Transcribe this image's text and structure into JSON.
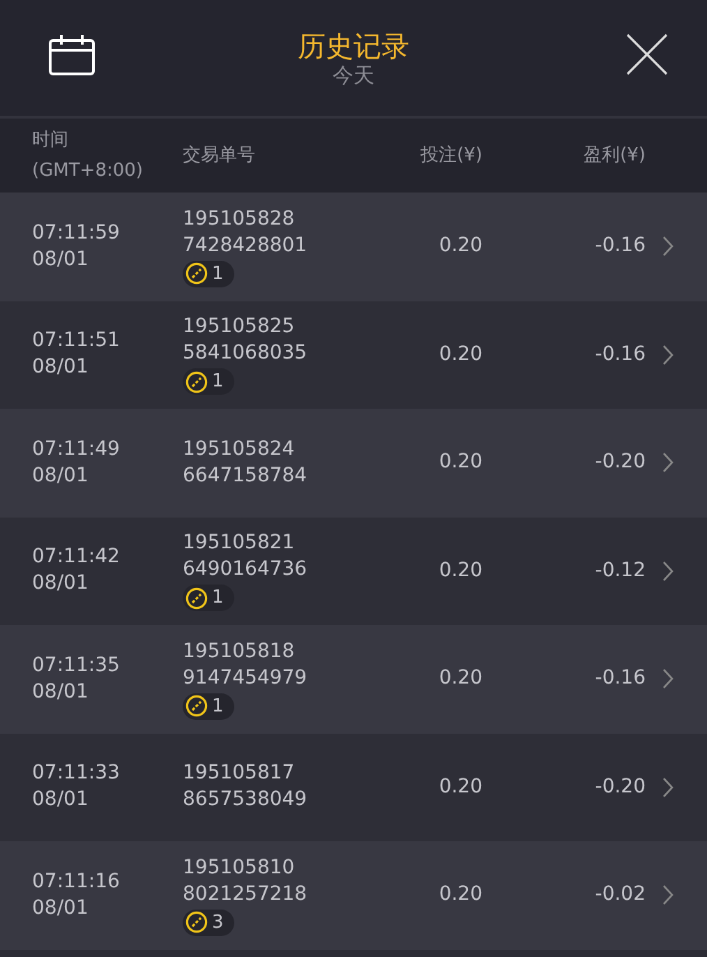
{
  "header": {
    "title": "历史记录",
    "subtitle": "今天"
  },
  "columns": [
    {
      "lines": [
        "时间",
        "(GMT+8:00)"
      ]
    },
    {
      "lines": [
        "交易单号"
      ]
    },
    {
      "lines": [
        "投注(¥)"
      ]
    },
    {
      "lines": [
        "盈利(¥)"
      ]
    }
  ],
  "rows": [
    {
      "time": "07:11:59",
      "date": "08/01",
      "order": [
        "195105828",
        "7428428801"
      ],
      "badge": "1",
      "stake": "0.20",
      "profit": "-0.16"
    },
    {
      "time": "07:11:51",
      "date": "08/01",
      "order": [
        "195105825",
        "5841068035"
      ],
      "badge": "1",
      "stake": "0.20",
      "profit": "-0.16"
    },
    {
      "time": "07:11:49",
      "date": "08/01",
      "order": [
        "195105824",
        "6647158784"
      ],
      "stake": "0.20",
      "profit": "-0.20"
    },
    {
      "time": "07:11:42",
      "date": "08/01",
      "order": [
        "195105821",
        "6490164736"
      ],
      "badge": "1",
      "stake": "0.20",
      "profit": "-0.12"
    },
    {
      "time": "07:11:35",
      "date": "08/01",
      "order": [
        "195105818",
        "9147454979"
      ],
      "badge": "1",
      "stake": "0.20",
      "profit": "-0.16"
    },
    {
      "time": "07:11:33",
      "date": "08/01",
      "order": [
        "195105817",
        "8657538049"
      ],
      "stake": "0.20",
      "profit": "-0.20"
    },
    {
      "time": "07:11:16",
      "date": "08/01",
      "order": [
        "195105810",
        "8021257218"
      ],
      "badge": "3",
      "stake": "0.20",
      "profit": "-0.02"
    }
  ]
}
